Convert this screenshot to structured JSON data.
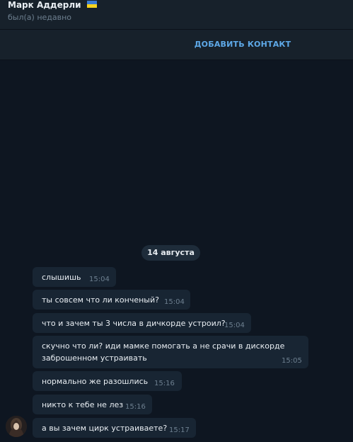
{
  "header": {
    "name": "Марк Аддерли",
    "flag_icon": "ukraine-flag-icon",
    "status": "был(а) недавно"
  },
  "actions": {
    "add_contact": "ДОБАВИТЬ КОНТАКТ"
  },
  "chat": {
    "date": "14 августа",
    "messages": [
      {
        "text": "слышишь",
        "time": "15:04"
      },
      {
        "text": "ты совсем что ли конченый?",
        "time": "15:04"
      },
      {
        "text": "что и зачем ты 3 числа в дичкорде устроил?",
        "time": "15:04"
      },
      {
        "lines": [
          "скучно что ли? иди мамке помогать а не срачи в дискорде",
          "заброшенном устраивать"
        ],
        "time": "15:05"
      },
      {
        "text": "нормально же разошлись",
        "time": "15:16"
      },
      {
        "text": "никто к тебе не лез",
        "time": "15:16"
      },
      {
        "text": "а вы зачем цирк устраиваете?",
        "time": "15:17"
      }
    ]
  },
  "colors": {
    "background": "#0e1621",
    "panel": "#17212b",
    "bubble": "#182533",
    "accent": "#5ea9e8",
    "muted": "#6d7f8f"
  }
}
